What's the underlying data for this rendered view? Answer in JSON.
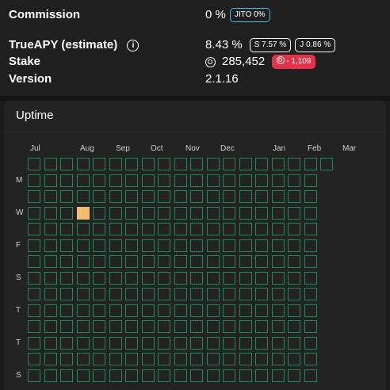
{
  "info": {
    "commission": {
      "label": "Commission",
      "value": "0 %",
      "badge": "JITO 0%"
    },
    "apy": {
      "label": "TrueAPY (estimate)",
      "value": "8.43 %",
      "badge_s": "S 7.57 %",
      "badge_j": "J 0.86 %"
    },
    "stake": {
      "label": "Stake",
      "value": "285,452",
      "delta": "- 1,109"
    },
    "version": {
      "label": "Version",
      "value": "2.1.16"
    }
  },
  "uptime": {
    "title": "Uptime",
    "months": [
      "Jul",
      "Aug",
      "Sep",
      "Oct",
      "Nov",
      "Dec",
      "Jan",
      "Feb",
      "Mar"
    ],
    "days": [
      "M",
      "W",
      "F",
      "S",
      "T",
      "T",
      "S"
    ],
    "grid": {
      "columns": 19,
      "rows": 14,
      "active_cells": [
        [
          3,
          3
        ]
      ]
    }
  },
  "colors": {
    "background": "#1b1b1b",
    "cell_border": "#1f8a56",
    "cell_active": "#f2bd6c",
    "jito_badge": "#39c5e6",
    "stake_delta": "#e2334a"
  }
}
